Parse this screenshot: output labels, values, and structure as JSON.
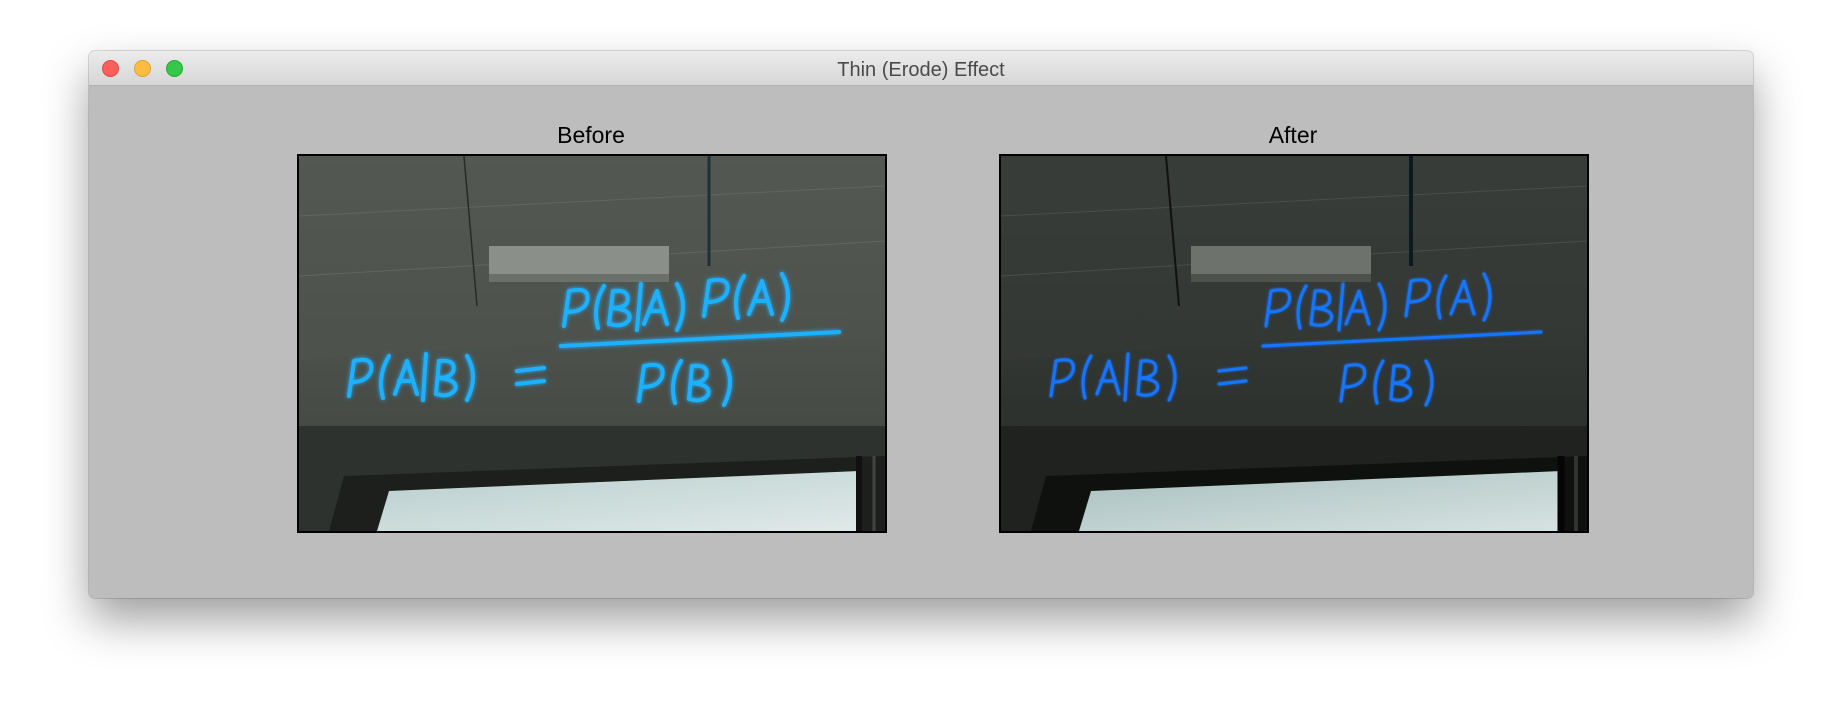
{
  "window": {
    "title": "Thin (Erode) Effect",
    "controls": {
      "close": "close-button",
      "minimize": "minimize-button",
      "zoom": "zoom-button"
    }
  },
  "panels": {
    "before": {
      "label": "Before",
      "image_description": "Neon sign of Bayes' theorem formula hanging from a ceiling above a window",
      "neon_color": "#1fb0ff"
    },
    "after": {
      "label": "After",
      "image_description": "Same neon Bayes' theorem sign with thinner, darker eroded strokes",
      "neon_color": "#1474ff"
    }
  },
  "colors": {
    "window_background": "#bdbdbd",
    "titlebar_top": "#ececec",
    "titlebar_bottom": "#d6d6d6",
    "close": "#fc605c",
    "minimize": "#fdbc40",
    "zoom": "#34c84a"
  }
}
